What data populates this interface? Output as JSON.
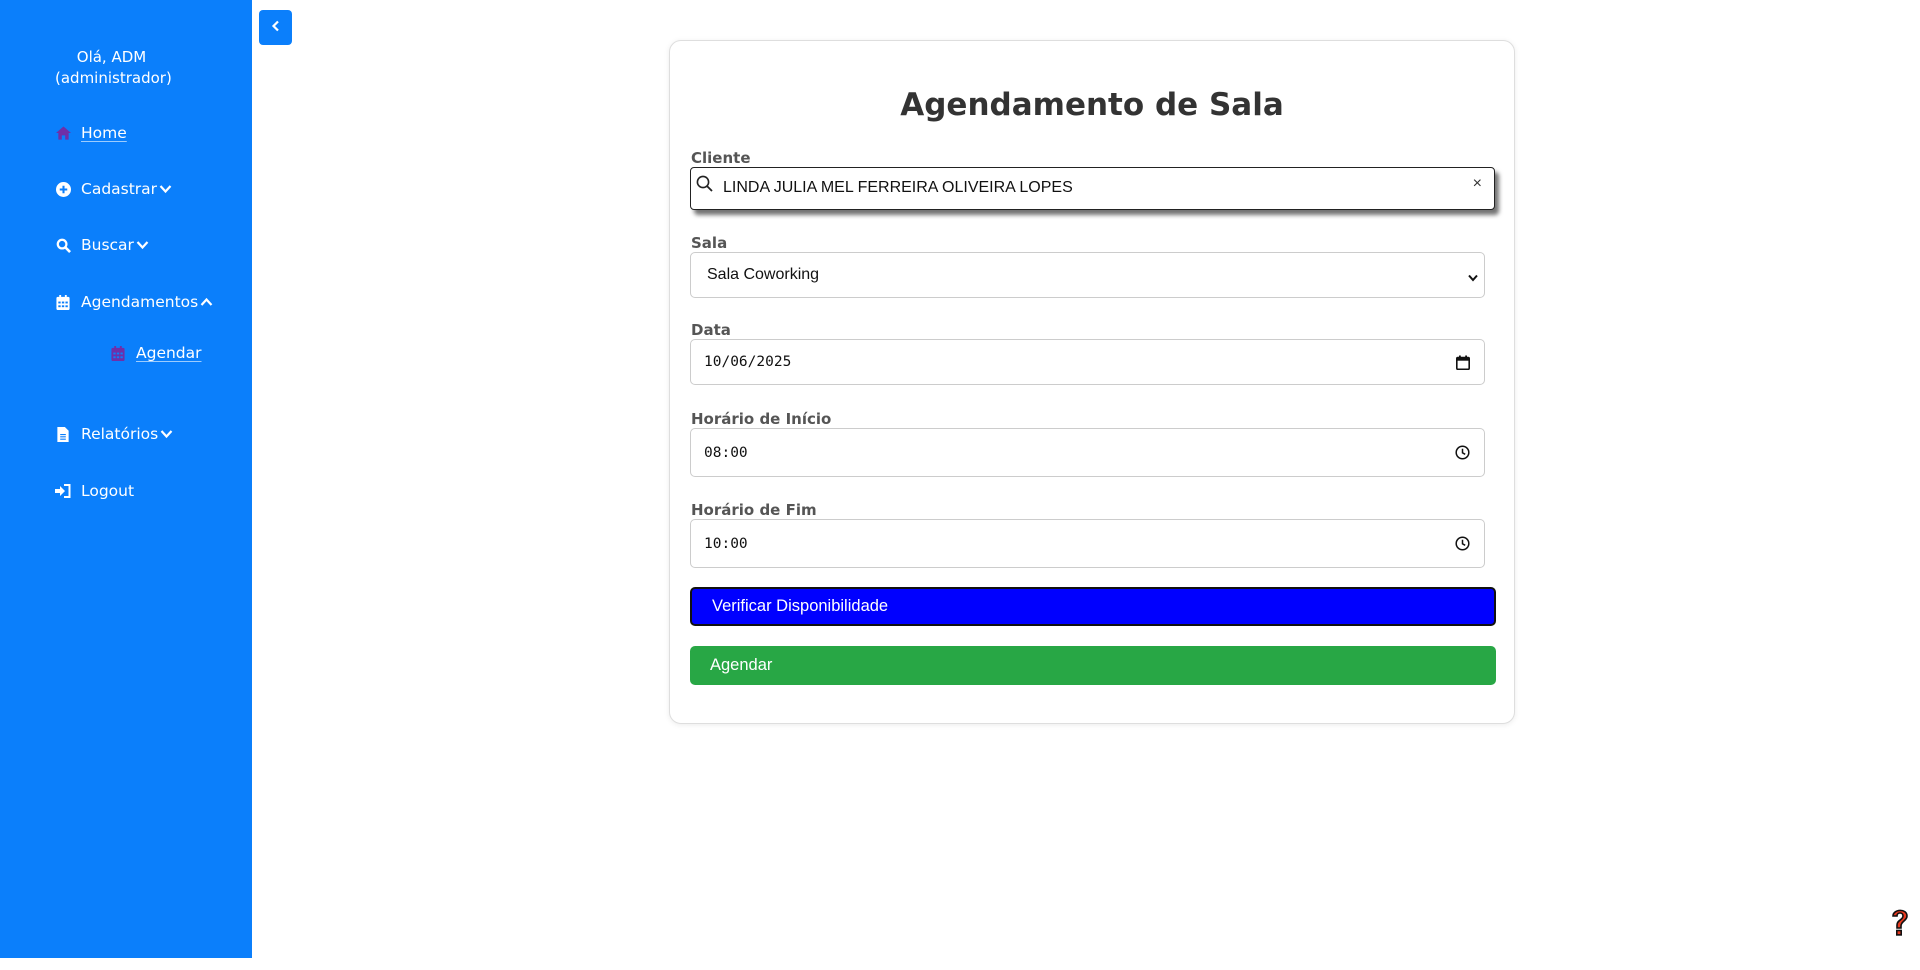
{
  "sidebar": {
    "greeting": "Olá, ADM (administrador)",
    "items": [
      {
        "label": "Home",
        "icon": "home-icon"
      },
      {
        "label": "Cadastrar",
        "icon": "plus-circle-icon"
      },
      {
        "label": "Buscar",
        "icon": "search-icon"
      },
      {
        "label": "Agendamentos",
        "icon": "calendar-icon"
      },
      {
        "label": "Agendar",
        "icon": "calendar-icon"
      },
      {
        "label": "Relatórios",
        "icon": "file-icon"
      },
      {
        "label": "Logout",
        "icon": "sign-out-icon"
      }
    ]
  },
  "form": {
    "title": "Agendamento de Sala",
    "cliente_label": "Cliente",
    "cliente_value": "LINDA JULIA MEL FERREIRA OLIVEIRA LOPES",
    "clear_label": "×",
    "sala_label": "Sala",
    "sala_value": "Sala Coworking",
    "data_label": "Data",
    "data_value": "10/06/2025",
    "inicio_label": "Horário de Início",
    "inicio_value": "08:00",
    "fim_label": "Horário de Fim",
    "fim_value": "10:00",
    "verificar_label": "Verificar Disponibilidade",
    "agendar_label": "Agendar"
  },
  "colors": {
    "sidebar": "#0b7ffb",
    "verificar": "#0000ff",
    "agendar": "#28a745",
    "active_icon": "#6f2fa8"
  }
}
